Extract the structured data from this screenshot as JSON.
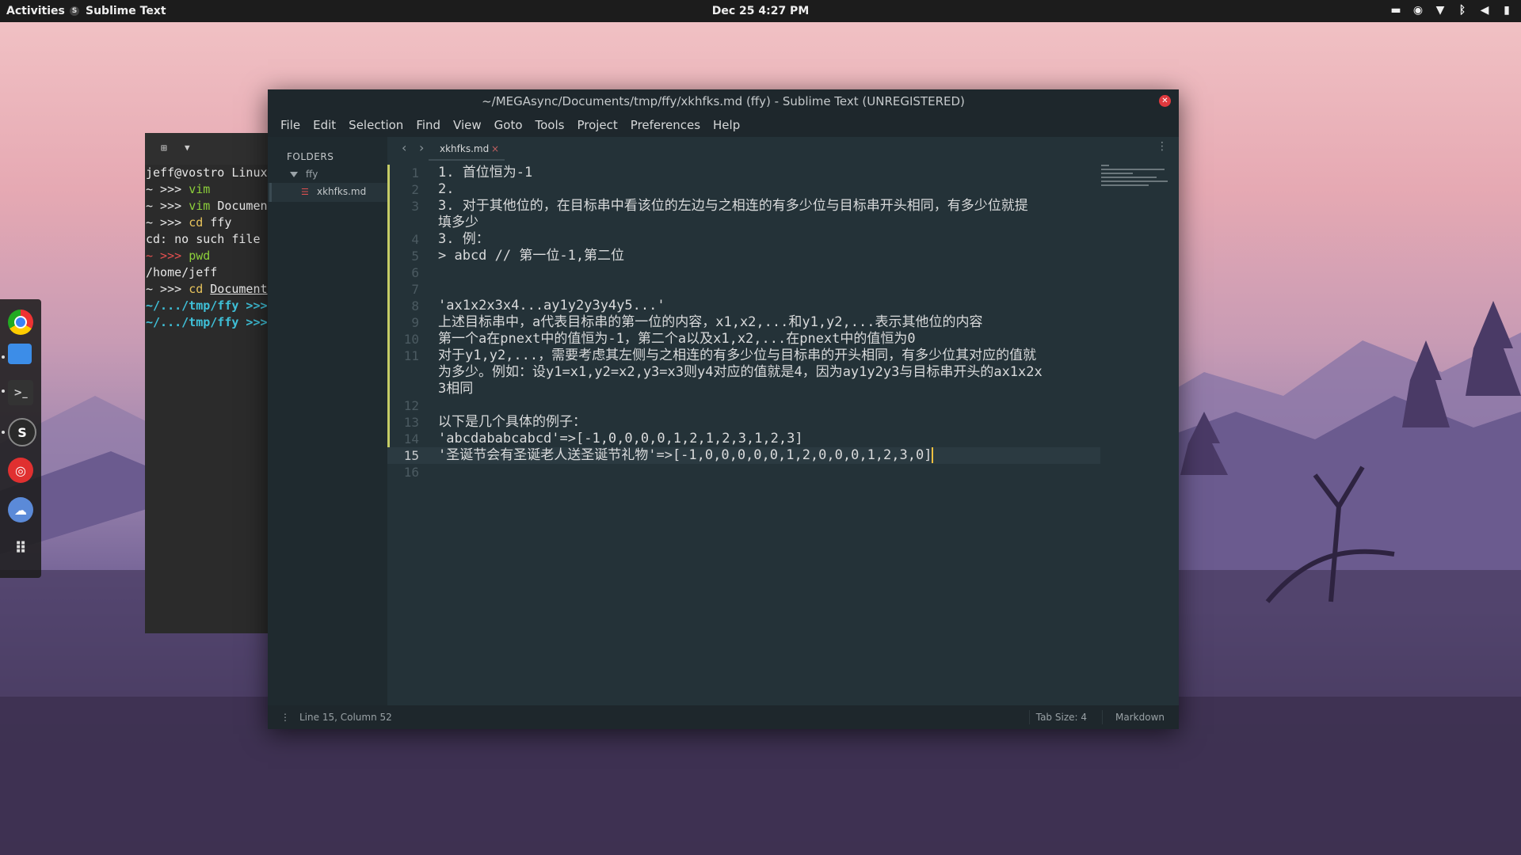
{
  "topbar": {
    "activities": "Activities",
    "app_name": "Sublime Text",
    "clock": "Dec 25  4:27 PM",
    "tray_icons": [
      "camera-icon",
      "accessibility-icon",
      "wifi-icon",
      "bluetooth-icon",
      "volume-icon",
      "battery-icon"
    ]
  },
  "dock": {
    "items": [
      "chrome-icon",
      "files-icon",
      "terminal-icon",
      "sublime-icon",
      "netease-music-icon",
      "chat-icon",
      "app-grid-icon"
    ]
  },
  "terminal": {
    "lines": [
      {
        "prompt": "",
        "cmd": "jeff@vostro Linux",
        "type": "plain"
      },
      {
        "prompt": "~ >>> ",
        "cmd": "vim",
        "type": "green"
      },
      {
        "prompt": "~ >>> ",
        "cmd": "vim Documen",
        "type": "mixed"
      },
      {
        "prompt": "~ >>> ",
        "cmd": "cd ffy",
        "type": "mixed2"
      },
      {
        "prompt": "",
        "cmd": "cd: no such file",
        "type": "plain"
      },
      {
        "prompt": "~ >>> ",
        "cmd": "pwd",
        "type": "red"
      },
      {
        "prompt": "",
        "cmd": "/home/jeff",
        "type": "plain"
      },
      {
        "prompt": "~ >>> ",
        "cmd": "cd Document",
        "type": "under"
      },
      {
        "prompt": "~/.../tmp/ffy >>> ",
        "cmd": "",
        "type": "cyan"
      },
      {
        "prompt": "~/.../tmp/ffy >>> ",
        "cmd": "",
        "type": "cyan"
      }
    ]
  },
  "sublime": {
    "title": "~/MEGAsync/Documents/tmp/ffy/xkhfks.md (ffy) - Sublime Text (UNREGISTERED)",
    "menu": [
      "File",
      "Edit",
      "Selection",
      "Find",
      "View",
      "Goto",
      "Tools",
      "Project",
      "Preferences",
      "Help"
    ],
    "sidebar": {
      "header": "FOLDERS",
      "folder": "ffy",
      "file": "xkhfks.md"
    },
    "tab": {
      "label": "xkhfks.md",
      "close": "×"
    },
    "lines": [
      {
        "n": "1",
        "t": "1. 首位恒为-1"
      },
      {
        "n": "2",
        "t": "2."
      },
      {
        "n": "3",
        "t": "3. 对于其他位的，在目标串中看该位的左边与之相连的有多少位与目标串开头相同，有多少位就提"
      },
      {
        "n": "",
        "t": "填多少"
      },
      {
        "n": "4",
        "t": "3. 例："
      },
      {
        "n": "5",
        "t": "> abcd // 第一位-1,第二位"
      },
      {
        "n": "6",
        "t": ""
      },
      {
        "n": "7",
        "t": ""
      },
      {
        "n": "8",
        "t": "'ax1x2x3x4...ay1y2y3y4y5...'"
      },
      {
        "n": "9",
        "t": "上述目标串中，a代表目标串的第一位的内容，x1,x2,...和y1,y2,...表示其他位的内容"
      },
      {
        "n": "10",
        "t": "第一个a在pnext中的值恒为-1，第二个a以及x1,x2,...在pnext中的值恒为0"
      },
      {
        "n": "11",
        "t": "对于y1,y2,...，需要考虑其左侧与之相连的有多少位与目标串的开头相同，有多少位其对应的值就"
      },
      {
        "n": "",
        "t": "为多少。例如：设y1=x1,y2=x2,y3=x3则y4对应的值就是4，因为ay1y2y3与目标串开头的ax1x2x"
      },
      {
        "n": "",
        "t": "3相同"
      },
      {
        "n": "12",
        "t": ""
      },
      {
        "n": "13",
        "t": "以下是几个具体的例子："
      },
      {
        "n": "14",
        "t": "'abcdababcabcd'=>[-1,0,0,0,0,1,2,1,2,3,1,2,3]"
      },
      {
        "n": "15",
        "t": "'圣诞节会有圣诞老人送圣诞节礼物'=>[-1,0,0,0,0,0,1,2,0,0,0,1,2,3,0]"
      },
      {
        "n": "16",
        "t": ""
      }
    ],
    "status": {
      "position": "Line 15, Column 52",
      "tab_size": "Tab Size: 4",
      "syntax": "Markdown"
    }
  }
}
